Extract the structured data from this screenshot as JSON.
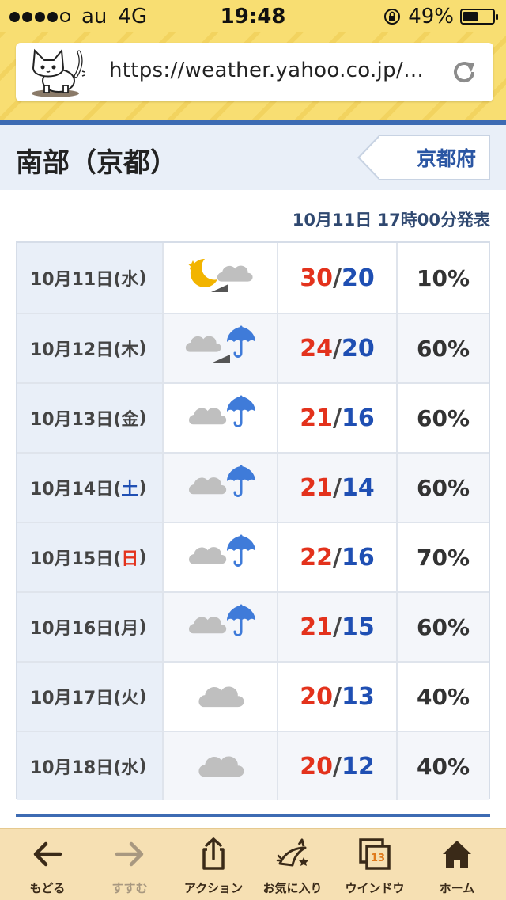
{
  "status_bar": {
    "carrier": "au",
    "network": "4G",
    "time": "19:48",
    "battery": "49%",
    "battery_level": 0.49,
    "signal_bars_filled": 4,
    "signal_bars_total": 5
  },
  "browser": {
    "url": "https://weather.yahoo.co.jp/…",
    "site_icon": "cat-icon",
    "reload_icon": "reload-icon"
  },
  "header": {
    "title": "南部（京都）",
    "prefecture_button": "京都府",
    "issued": "10月11日 17時00分発表"
  },
  "forecast": [
    {
      "date": "10月11日(",
      "weekday": "水",
      "close": ")",
      "weekday_type": "normal",
      "icon": "moon-cloud-icon",
      "high": "30",
      "low": "20",
      "pop": "10%"
    },
    {
      "date": "10月12日(",
      "weekday": "木",
      "close": ")",
      "weekday_type": "normal",
      "icon": "cloud-then-rain-icon",
      "high": "24",
      "low": "20",
      "pop": "60%"
    },
    {
      "date": "10月13日(",
      "weekday": "金",
      "close": ")",
      "weekday_type": "normal",
      "icon": "cloud-rain-icon",
      "high": "21",
      "low": "16",
      "pop": "60%"
    },
    {
      "date": "10月14日(",
      "weekday": "土",
      "close": ")",
      "weekday_type": "sat",
      "icon": "cloud-rain-icon",
      "high": "21",
      "low": "14",
      "pop": "60%"
    },
    {
      "date": "10月15日(",
      "weekday": "日",
      "close": ")",
      "weekday_type": "sun",
      "icon": "cloud-rain-icon",
      "high": "22",
      "low": "16",
      "pop": "70%"
    },
    {
      "date": "10月16日(",
      "weekday": "月",
      "close": ")",
      "weekday_type": "normal",
      "icon": "cloud-rain-icon",
      "high": "21",
      "low": "15",
      "pop": "60%"
    },
    {
      "date": "10月17日(",
      "weekday": "火",
      "close": ")",
      "weekday_type": "normal",
      "icon": "cloud-icon",
      "high": "20",
      "low": "13",
      "pop": "40%"
    },
    {
      "date": "10月18日(",
      "weekday": "水",
      "close": ")",
      "weekday_type": "normal",
      "icon": "cloud-icon",
      "high": "20",
      "low": "12",
      "pop": "40%"
    }
  ],
  "temp_slash": "/",
  "toolbar": {
    "back": "もどる",
    "forward": "すすむ",
    "action": "アクション",
    "favorites": "お気に入り",
    "windows": "ウインドウ",
    "windows_count": "13",
    "home": "ホーム"
  },
  "colors": {
    "high_temp": "#e3321c",
    "low_temp": "#1f4fb3",
    "accent_blue": "#3d6bb3",
    "header_yellow": "#f8de72"
  }
}
